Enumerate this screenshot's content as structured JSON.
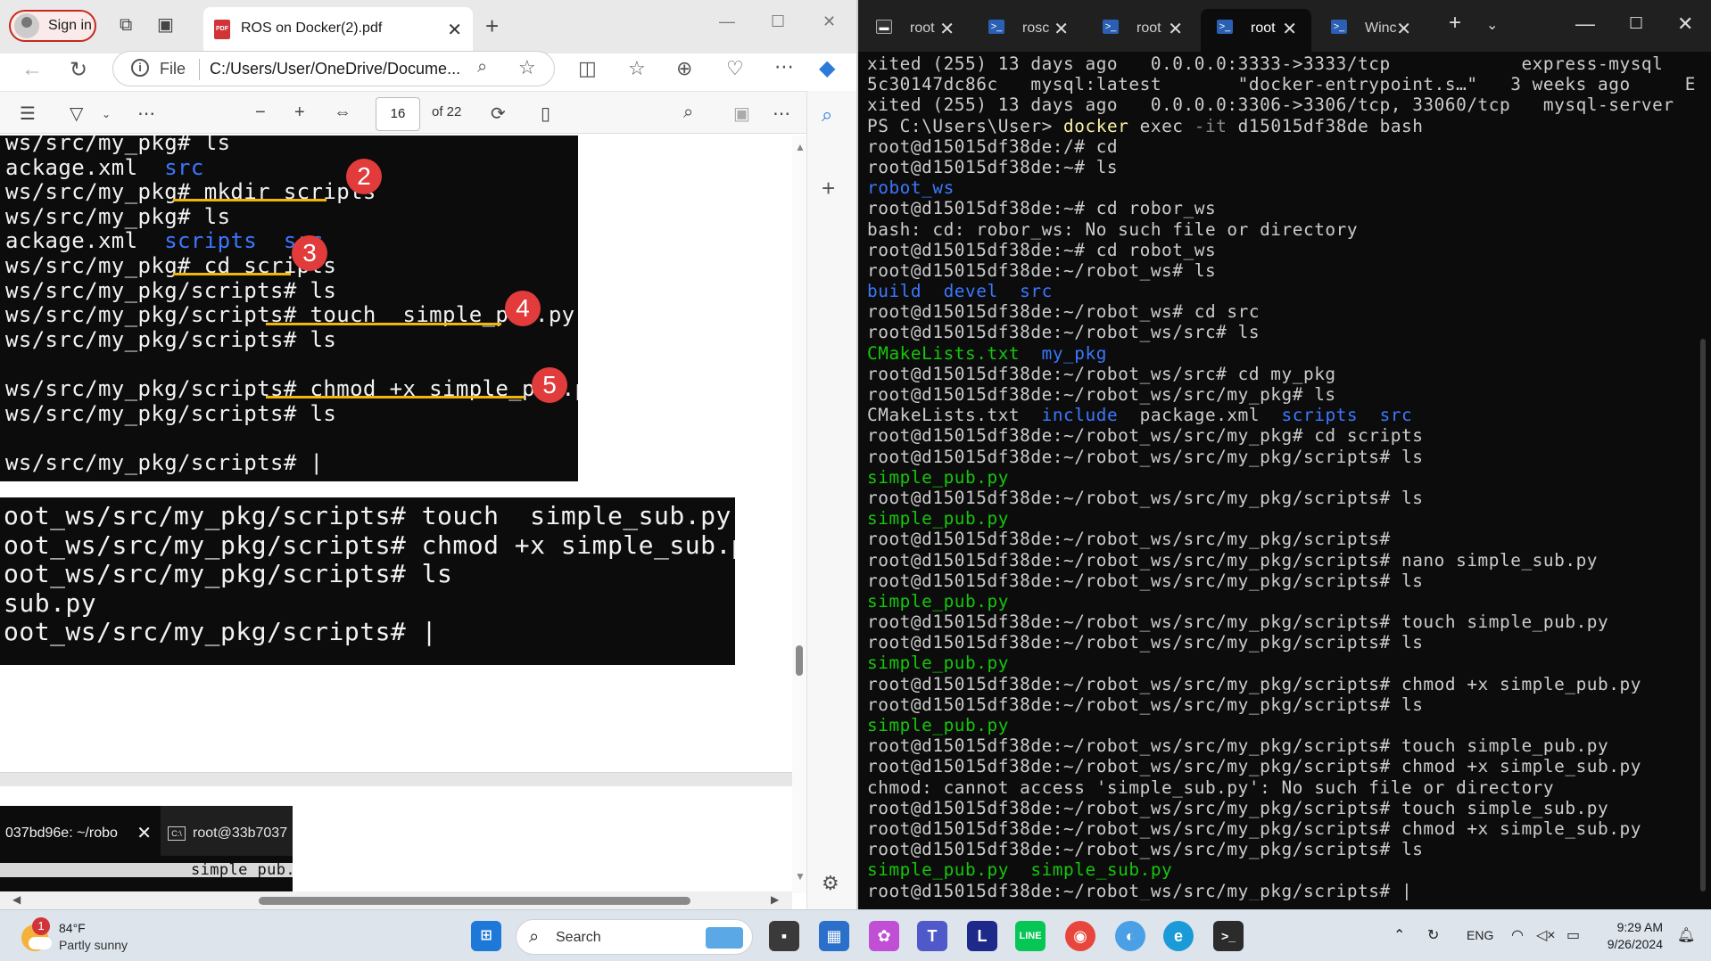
{
  "edge": {
    "signin_label": "Sign in",
    "tab_title": "ROS on Docker(2).pdf",
    "url_scheme": "File",
    "url": "C:/Users/User/OneDrive/Docume...",
    "page_number": "16",
    "page_of": "of 22"
  },
  "pdf": {
    "shot1_lines": [
      "ws/src/my_pkg# ls",
      "ackage.xml  src",
      "ws/src/my_pkg# mkdir scripts",
      "ws/src/my_pkg# ls",
      "ackage.xml  scripts  src",
      "ws/src/my_pkg# cd scripts",
      "ws/src/my_pkg/scripts# ls",
      "ws/src/my_pkg/scripts# touch  simple_pub.py",
      "ws/src/my_pkg/scripts# ls",
      "",
      "ws/src/my_pkg/scripts# chmod +x simple_pub.py",
      "ws/src/my_pkg/scripts# ls",
      "",
      "ws/src/my_pkg/scripts# |"
    ],
    "badges": [
      "2",
      "3",
      "4",
      "5"
    ],
    "shot2_lines": [
      "oot_ws/src/my_pkg/scripts# touch  simple_sub.py",
      "oot_ws/src/my_pkg/scripts# chmod +x simple_sub.py",
      "oot_ws/src/my_pkg/scripts# ls",
      "sub.py",
      "oot_ws/src/my_pkg/scripts# |"
    ],
    "shot3_tab1": "037bd96e: ~/robo",
    "shot3_tab2": "root@33b7037",
    "shot3_file": "simple_pub."
  },
  "terminal": {
    "tabs": [
      "root",
      "rosc",
      "root",
      "root",
      "Winc"
    ],
    "lines": [
      "xited (255) 13 days ago   0.0.0.0:3333->3333/tcp            express-mysql",
      "5c30147dc86c   mysql:latest       \"docker-entrypoint.s…\"   3 weeks ago     E",
      "xited (255) 13 days ago   0.0.0.0:3306->3306/tcp, 33060/tcp   mysql-server",
      "PS C:\\Users\\User> docker exec -it d15015df38de bash",
      "root@d15015df38de:/# cd",
      "root@d15015df38de:~# ls",
      "robot_ws",
      "root@d15015df38de:~# cd robor_ws",
      "bash: cd: robor_ws: No such file or directory",
      "root@d15015df38de:~# cd robot_ws",
      "root@d15015df38de:~/robot_ws# ls",
      "build  devel  src",
      "root@d15015df38de:~/robot_ws# cd src",
      "root@d15015df38de:~/robot_ws/src# ls",
      "CMakeLists.txt  my_pkg",
      "root@d15015df38de:~/robot_ws/src# cd my_pkg",
      "root@d15015df38de:~/robot_ws/src/my_pkg# ls",
      "CMakeLists.txt  include  package.xml  scripts  src",
      "root@d15015df38de:~/robot_ws/src/my_pkg# cd scripts",
      "root@d15015df38de:~/robot_ws/src/my_pkg/scripts# ls",
      "simple_pub.py",
      "root@d15015df38de:~/robot_ws/src/my_pkg/scripts# ls",
      "simple_pub.py",
      "root@d15015df38de:~/robot_ws/src/my_pkg/scripts#",
      "root@d15015df38de:~/robot_ws/src/my_pkg/scripts# nano simple_sub.py",
      "root@d15015df38de:~/robot_ws/src/my_pkg/scripts# ls",
      "simple_pub.py",
      "root@d15015df38de:~/robot_ws/src/my_pkg/scripts# touch simple_pub.py",
      "root@d15015df38de:~/robot_ws/src/my_pkg/scripts# ls",
      "simple_pub.py",
      "root@d15015df38de:~/robot_ws/src/my_pkg/scripts# chmod +x simple_pub.py",
      "root@d15015df38de:~/robot_ws/src/my_pkg/scripts# ls",
      "simple_pub.py",
      "root@d15015df38de:~/robot_ws/src/my_pkg/scripts# touch simple_pub.py",
      "root@d15015df38de:~/robot_ws/src/my_pkg/scripts# chmod +x simple_sub.py",
      "chmod: cannot access 'simple_sub.py': No such file or directory",
      "root@d15015df38de:~/robot_ws/src/my_pkg/scripts# touch simple_sub.py",
      "root@d15015df38de:~/robot_ws/src/my_pkg/scripts# chmod +x simple_sub.py",
      "root@d15015df38de:~/robot_ws/src/my_pkg/scripts# ls",
      "simple_pub.py  simple_sub.py",
      "root@d15015df38de:~/robot_ws/src/my_pkg/scripts# |"
    ]
  },
  "taskbar": {
    "weather_badge": "1",
    "temperature": "84°F",
    "condition": "Partly sunny",
    "search_label": "Search",
    "language": "ENG",
    "time": "9:29 AM",
    "date": "9/26/2024"
  },
  "colors": {
    "terminal_bg": "#0c0c0c",
    "terminal_blue": "#3b78ff",
    "terminal_green": "#16c60c",
    "underline": "#f2b705",
    "badge_red": "#e23b3b"
  }
}
